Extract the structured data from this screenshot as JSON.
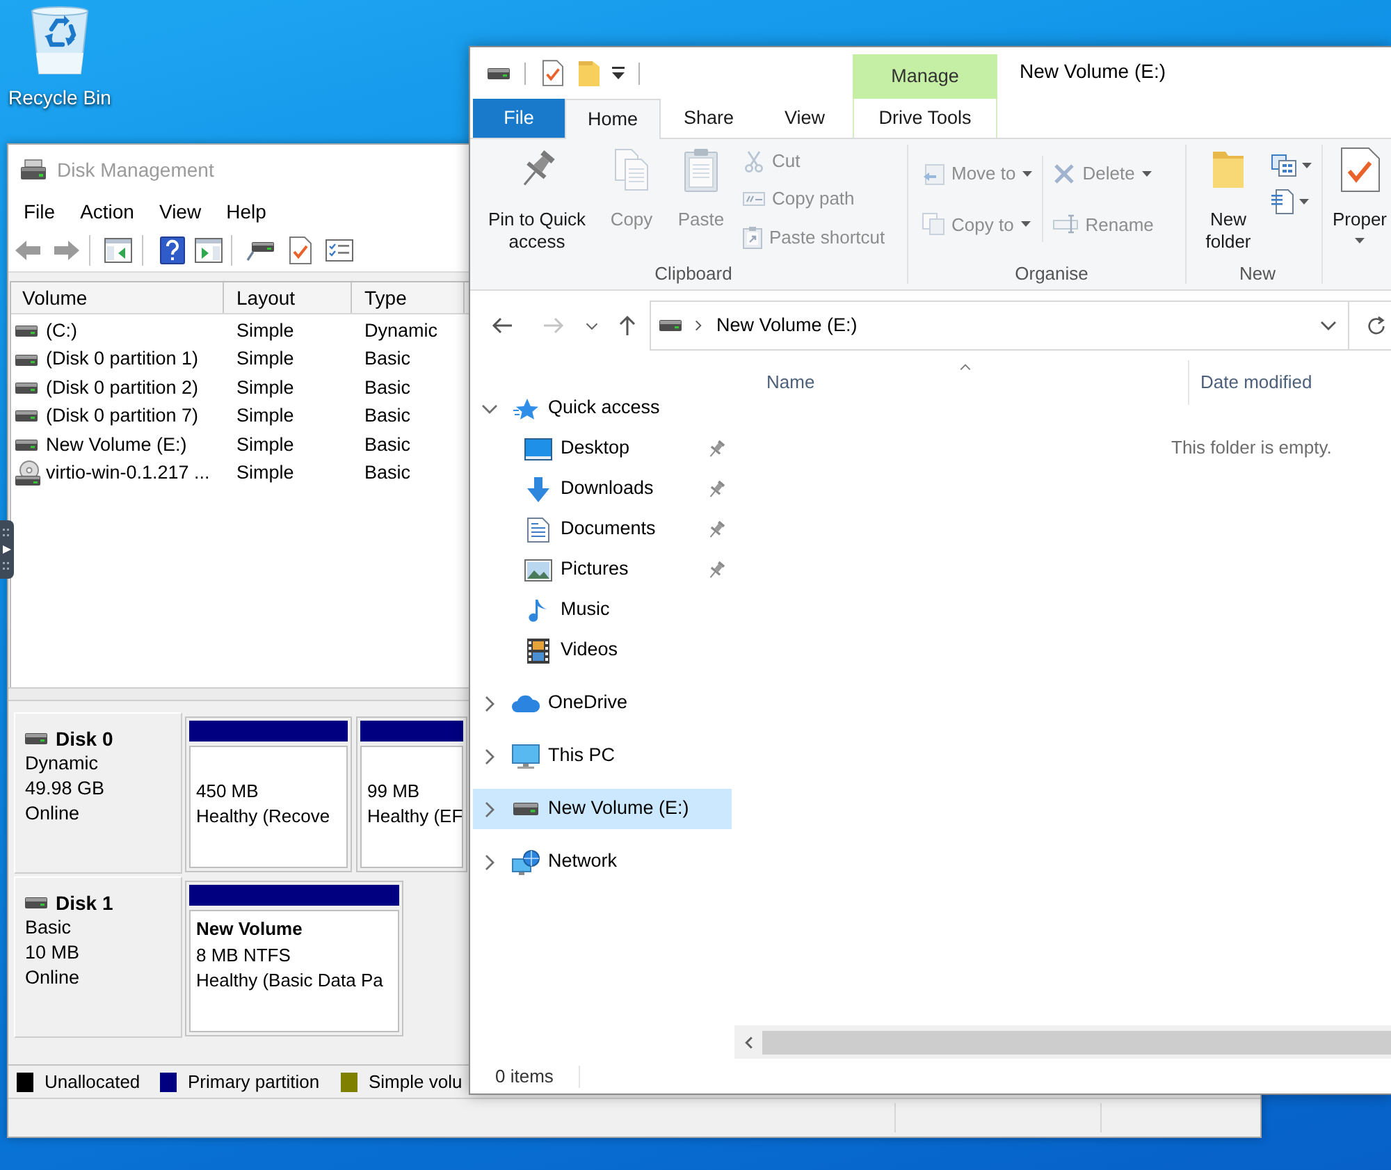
{
  "desktop": {
    "icons": [
      {
        "label": "Recycle Bin"
      }
    ]
  },
  "disk_management": {
    "title": "Disk Management",
    "menu": [
      "File",
      "Action",
      "View",
      "Help"
    ],
    "volume_list": {
      "columns": [
        "Volume",
        "Layout",
        "Type"
      ],
      "rows": [
        {
          "kind": "drive",
          "cells": [
            "(C:)",
            "Simple",
            "Dynamic"
          ]
        },
        {
          "kind": "drive",
          "cells": [
            "(Disk 0 partition 1)",
            "Simple",
            "Basic"
          ]
        },
        {
          "kind": "drive",
          "cells": [
            "(Disk 0 partition 2)",
            "Simple",
            "Basic"
          ]
        },
        {
          "kind": "drive",
          "cells": [
            "(Disk 0 partition 7)",
            "Simple",
            "Basic"
          ]
        },
        {
          "kind": "drive",
          "cells": [
            "New Volume (E:)",
            "Simple",
            "Basic"
          ]
        },
        {
          "kind": "disc",
          "cells": [
            "virtio-win-0.1.217 ...",
            "Simple",
            "Basic"
          ]
        }
      ]
    },
    "disks": [
      {
        "name": "Disk 0",
        "details": [
          "Dynamic",
          "49.98 GB",
          "Online"
        ],
        "partitions": [
          {
            "color": "#000080",
            "lines": [
              "450 MB",
              "Healthy (Recove"
            ]
          },
          {
            "color": "#000080",
            "lines": [
              "99 MB",
              "Healthy (EF"
            ]
          }
        ]
      },
      {
        "name": "Disk 1",
        "details": [
          "Basic",
          "10 MB",
          "Online"
        ],
        "partitions": [
          {
            "color": "#000080",
            "name": "New Volume",
            "lines": [
              "8 MB NTFS",
              "Healthy (Basic Data Pa"
            ]
          }
        ]
      }
    ],
    "legend": [
      {
        "label": "Unallocated",
        "color": "#000000"
      },
      {
        "label": "Primary partition",
        "color": "#000080"
      },
      {
        "label": "Simple volu",
        "color": "#808000"
      }
    ]
  },
  "explorer": {
    "title": "New Volume (E:)",
    "ribbon": {
      "contextual_header": "Manage",
      "tabs": [
        {
          "label": "File",
          "kind": "backstage",
          "selected": false
        },
        {
          "label": "Home",
          "kind": "standard",
          "selected": true
        },
        {
          "label": "Share",
          "kind": "standard",
          "selected": false
        },
        {
          "label": "View",
          "kind": "standard",
          "selected": false
        },
        {
          "label": "Drive Tools",
          "kind": "contextual",
          "selected": false
        }
      ],
      "groups": [
        {
          "label": "Clipboard",
          "columns": [
            [
              {
                "kind": "large",
                "label": "Pin to Quick access",
                "disabled": false,
                "dropdown": false
              }
            ],
            [
              {
                "kind": "large",
                "label": "Copy",
                "disabled": true,
                "dropdown": false
              }
            ],
            [
              {
                "kind": "large",
                "label": "Paste",
                "disabled": true,
                "dropdown": false
              }
            ],
            [
              {
                "kind": "small",
                "label": "Cut",
                "disabled": true,
                "dropdown": false
              },
              {
                "kind": "small",
                "label": "Copy path",
                "disabled": true,
                "dropdown": false
              },
              {
                "kind": "small",
                "label": "Paste shortcut",
                "disabled": true,
                "dropdown": false
              }
            ]
          ]
        },
        {
          "label": "Organise",
          "columns": [
            [
              {
                "kind": "small",
                "label": "Move to",
                "disabled": true,
                "dropdown": true
              },
              {
                "kind": "small",
                "label": "Copy to",
                "disabled": true,
                "dropdown": true
              }
            ],
            [
              {
                "kind": "small",
                "label": "Delete",
                "disabled": true,
                "dropdown": true
              },
              {
                "kind": "small",
                "label": "Rename",
                "disabled": true,
                "dropdown": false
              }
            ]
          ]
        },
        {
          "label": "New",
          "columns": [
            [
              {
                "kind": "large",
                "label": "New folder",
                "disabled": false,
                "dropdown": false
              }
            ],
            [
              {
                "kind": "icon",
                "disabled": false,
                "dropdown": true
              },
              {
                "kind": "icon",
                "disabled": false,
                "dropdown": true
              }
            ]
          ]
        },
        {
          "columns": [
            [
              {
                "kind": "large",
                "label": "Proper",
                "disabled": false,
                "dropdown": true
              }
            ]
          ]
        }
      ]
    },
    "address_bar": {
      "can_go_back": true,
      "can_go_forward": false,
      "path": [
        "New Volume (E:)"
      ]
    },
    "navigation": [
      {
        "label": "Quick access",
        "expanded": true,
        "selected": false,
        "children": [
          {
            "label": "Desktop",
            "pinned": true,
            "selected": false
          },
          {
            "label": "Downloads",
            "pinned": true,
            "selected": false
          },
          {
            "label": "Documents",
            "pinned": true,
            "selected": false
          },
          {
            "label": "Pictures",
            "pinned": true,
            "selected": false
          },
          {
            "label": "Music",
            "pinned": false,
            "selected": false
          },
          {
            "label": "Videos",
            "pinned": false,
            "selected": false
          }
        ]
      },
      {
        "label": "OneDrive",
        "expanded": false,
        "selected": false
      },
      {
        "label": "This PC",
        "expanded": false,
        "selected": false
      },
      {
        "label": "New Volume (E:)",
        "expanded": false,
        "selected": true
      },
      {
        "label": "Network",
        "expanded": false,
        "selected": false
      }
    ],
    "file_list": {
      "columns": [
        {
          "label": "Name",
          "sorted": true
        },
        {
          "label": "Date modified",
          "sorted": false
        }
      ],
      "empty_message": "This folder is empty."
    },
    "status_bar": {
      "item_count": "0 items"
    }
  }
}
